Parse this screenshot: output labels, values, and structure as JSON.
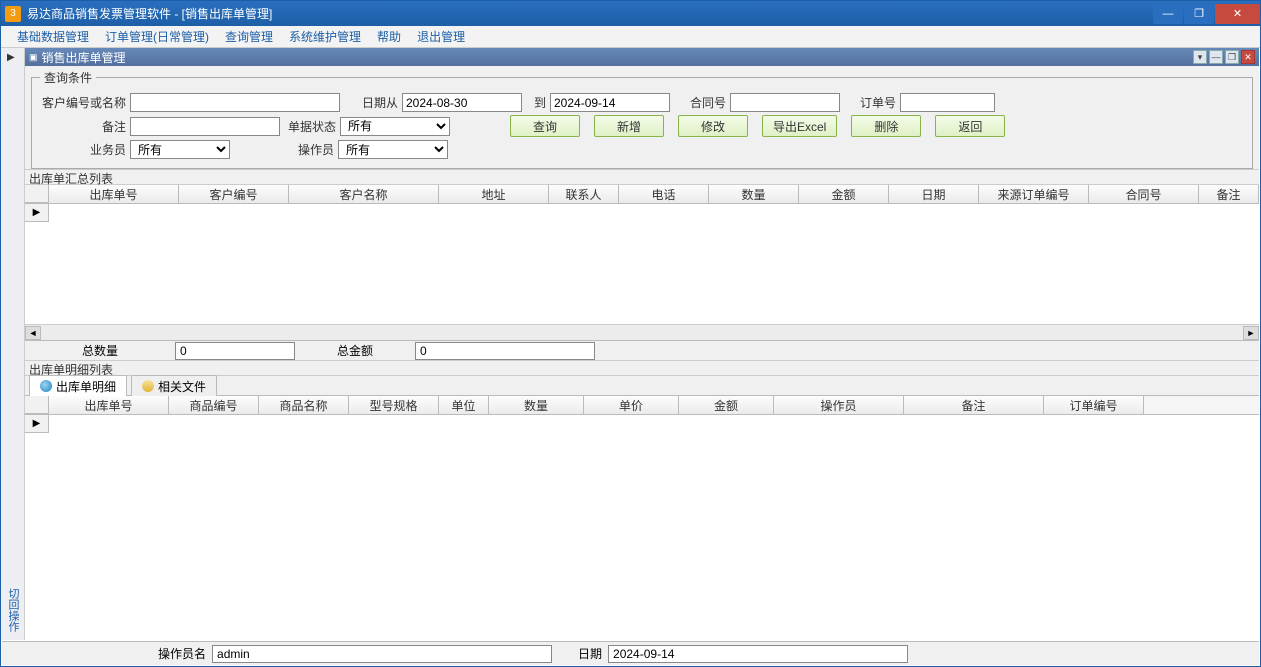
{
  "window": {
    "title": "易达商品销售发票管理软件  - [销售出库单管理]",
    "app_icon_text": "3"
  },
  "menu": [
    "基础数据管理",
    "订单管理(日常管理)",
    "查询管理",
    "系统维护管理",
    "帮助",
    "退出管理"
  ],
  "sub_tab": {
    "title": "销售出库单管理"
  },
  "left_gutter": {
    "text": "切回操作"
  },
  "query": {
    "legend": "查询条件",
    "labels": {
      "customer": "客户编号或名称",
      "date_from": "日期从",
      "to": "到",
      "contract": "合同号",
      "order": "订单号",
      "remark": "备注",
      "doc_status": "单据状态",
      "salesman": "业务员",
      "operator": "操作员"
    },
    "values": {
      "customer": "",
      "date_from": "2024-08-30",
      "date_to": "2024-09-14",
      "contract": "",
      "order": "",
      "remark": "",
      "doc_status": "所有",
      "salesman": "所有",
      "operator": "所有"
    },
    "buttons": {
      "search": "查询",
      "new": "新增",
      "edit": "修改",
      "export": "导出Excel",
      "delete": "删除",
      "back": "返回"
    }
  },
  "section1": {
    "title": "出库单汇总列表"
  },
  "grid1_cols": [
    "出库单号",
    "客户编号",
    "客户名称",
    "地址",
    "联系人",
    "电话",
    "数量",
    "金额",
    "日期",
    "来源订单编号",
    "合同号",
    "备注"
  ],
  "totals": {
    "qty_label": "总数量",
    "qty_value": "0",
    "amt_label": "总金额",
    "amt_value": "0"
  },
  "section2": {
    "title": "出库单明细列表"
  },
  "detail_tabs": {
    "t1": "出库单明细",
    "t2": "相关文件"
  },
  "grid2_cols": [
    "出库单号",
    "商品编号",
    "商品名称",
    "型号规格",
    "单位",
    "数量",
    "单价",
    "金额",
    "操作员",
    "备注",
    "订单编号"
  ],
  "status": {
    "op_label": "操作员名",
    "op_value": "admin",
    "date_label": "日期",
    "date_value": "2024-09-14"
  }
}
